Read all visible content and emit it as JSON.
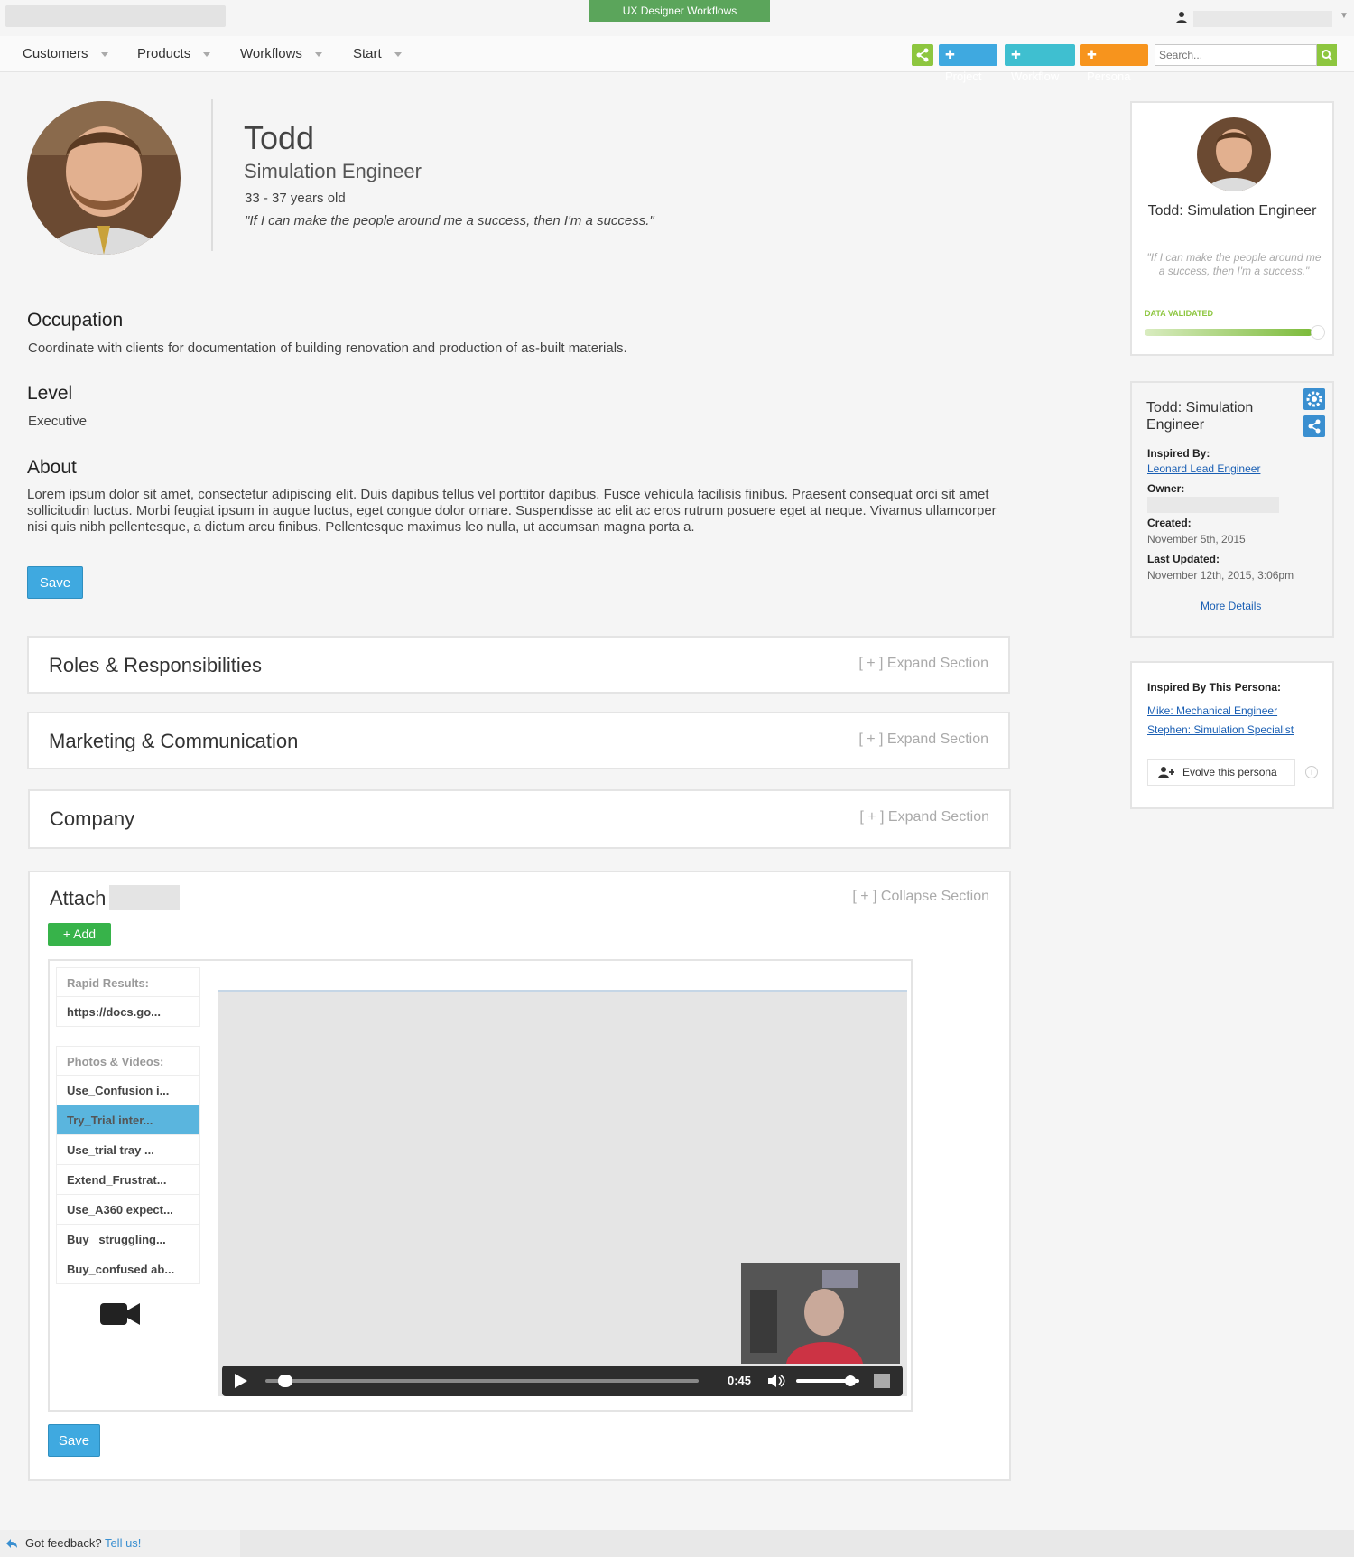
{
  "topbar": {
    "app_tab": "UX Designer Workflows"
  },
  "nav": {
    "items": [
      "Customers",
      "Products",
      "Workflows",
      "Start"
    ],
    "project_label": "Project",
    "workflow_label": "Workflow",
    "persona_label": "Persona",
    "search_placeholder": "Search..."
  },
  "persona": {
    "name": "Todd",
    "title": "Simulation Engineer",
    "age": "33 - 37 years old",
    "quote": "\"If I can make the people around me a success, then I'm a  success.\""
  },
  "sections": {
    "occupation_heading": "Occupation",
    "occupation_text": "Coordinate with clients for documentation of building renovation and production of as-built materials.",
    "level_heading": "Level",
    "level_text": "Executive",
    "about_heading": "About",
    "about_text": "Lorem ipsum dolor sit amet, consectetur adipiscing elit. Duis dapibus tellus vel porttitor dapibus. Fusce vehicula facilisis finibus. Praesent consequat orci sit amet sollicitudin luctus. Morbi feugiat ipsum in augue luctus, eget congue dolor ornare. Suspendisse ac elit ac eros rutrum posuere eget at neque. Vivamus ullamcorper nisi quis nibh pellentesque, a dictum arcu finibus. Pellentesque maximus leo nulla, ut accumsan magna porta a.",
    "save_label": "Save"
  },
  "panels": {
    "roles": "Roles & Responsibilities",
    "marketing": "Marketing & Communication",
    "company": "Company",
    "expand_label": "[ + ] Expand Section",
    "attach_title": "Attach",
    "collapse_label": "[ + ] Collapse Section",
    "add_label": "+ Add"
  },
  "attachments": {
    "rapid_heading": "Rapid Results:",
    "rapid_items": [
      "https://docs.go..."
    ],
    "photos_heading": "Photos & Videos:",
    "photo_items": [
      "Use_Confusion i...",
      "Try_Trial inter...",
      "Use_trial tray ...",
      "Extend_Frustrat...",
      "Use_A360 expect...",
      "Buy_ struggling...",
      "Buy_confused ab..."
    ],
    "selected_index": 1,
    "video_time": "0:45",
    "progress": 0.03,
    "volume": 0.85
  },
  "card1": {
    "title": "Todd: Simulation Engineer",
    "quote": "\"If I can make the people around me a success, then I'm a success.\"",
    "validated_label": "DATA VALIDATED",
    "validated_fraction": 0.95
  },
  "card2": {
    "title": "Todd: Simulation Engineer",
    "inspired_label": "Inspired By:",
    "inspired_link": "Leonard Lead Engineer",
    "owner_label": "Owner:",
    "created_label": "Created:",
    "created_value": "November 5th, 2015",
    "updated_label": "Last Updated:",
    "updated_value": "November 12th, 2015, 3:06pm",
    "more_details": "More Details"
  },
  "card3": {
    "label": "Inspired By This Persona:",
    "links": [
      "Mike: Mechanical Engineer",
      "Stephen: Simulation Specialist"
    ],
    "evolve_label": "Evolve this persona"
  },
  "footer": {
    "text": "Got feedback?",
    "link": "Tell us!"
  },
  "colors": {
    "accent_blue": "#3fa9e0",
    "green": "#8dc63f",
    "orange": "#f7941d",
    "app_tab": "#5ba55b"
  }
}
